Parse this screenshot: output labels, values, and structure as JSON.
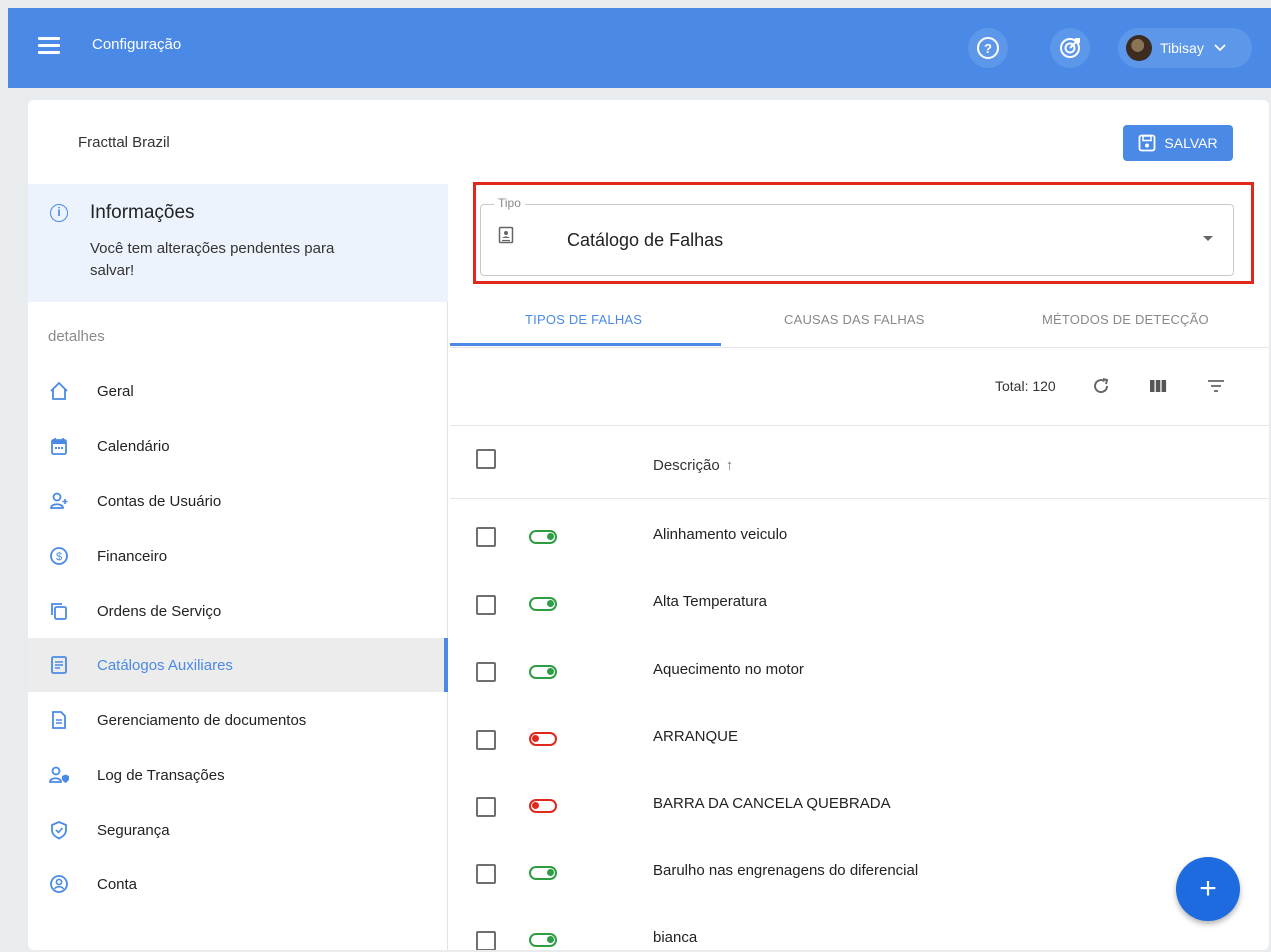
{
  "header": {
    "title": "Configuração",
    "user_name": "Tibisay"
  },
  "company": {
    "name": "Fracttal Brazil"
  },
  "actions": {
    "save_label": "SALVAR"
  },
  "info": {
    "title": "Informações",
    "text": "Você tem alterações pendentes para salvar!"
  },
  "sidebar": {
    "section_label": "detalhes",
    "items": [
      {
        "label": "Geral",
        "icon": "home-icon"
      },
      {
        "label": "Calendário",
        "icon": "calendar-icon"
      },
      {
        "label": "Contas de Usuário",
        "icon": "add-user-icon"
      },
      {
        "label": "Financeiro",
        "icon": "dollar-icon"
      },
      {
        "label": "Ordens de Serviço",
        "icon": "copy-icon"
      },
      {
        "label": "Catálogos Auxiliares",
        "icon": "catalog-icon",
        "active": true
      },
      {
        "label": "Gerenciamento de documentos",
        "icon": "document-icon"
      },
      {
        "label": "Log de Transações",
        "icon": "user-log-icon"
      },
      {
        "label": "Segurança",
        "icon": "shield-icon"
      },
      {
        "label": "Conta",
        "icon": "account-icon"
      }
    ]
  },
  "tipo": {
    "label": "Tipo",
    "value": "Catálogo de Falhas"
  },
  "tabs": [
    {
      "label": "TIPOS DE FALHAS",
      "active": true
    },
    {
      "label": "CAUSAS DAS FALHAS"
    },
    {
      "label": "MÉTODOS DE DETECÇÃO"
    }
  ],
  "table": {
    "total_label": "Total: 120",
    "column_header": "Descrição",
    "sort_indicator": "↑",
    "rows": [
      {
        "description": "Alinhamento veiculo",
        "active": true
      },
      {
        "description": "Alta Temperatura",
        "active": true
      },
      {
        "description": "Aquecimento no motor",
        "active": true
      },
      {
        "description": "ARRANQUE",
        "active": false
      },
      {
        "description": "BARRA DA CANCELA QUEBRADA",
        "active": false
      },
      {
        "description": "Barulho nas engrenagens do diferencial",
        "active": true
      },
      {
        "description": "bianca",
        "active": true
      }
    ]
  },
  "fab": {
    "label": "+"
  },
  "colors": {
    "primary": "#4a8ae6",
    "active_toggle": "#2e9e44",
    "inactive_toggle": "#e0281c",
    "highlight_border": "#e0281c"
  }
}
